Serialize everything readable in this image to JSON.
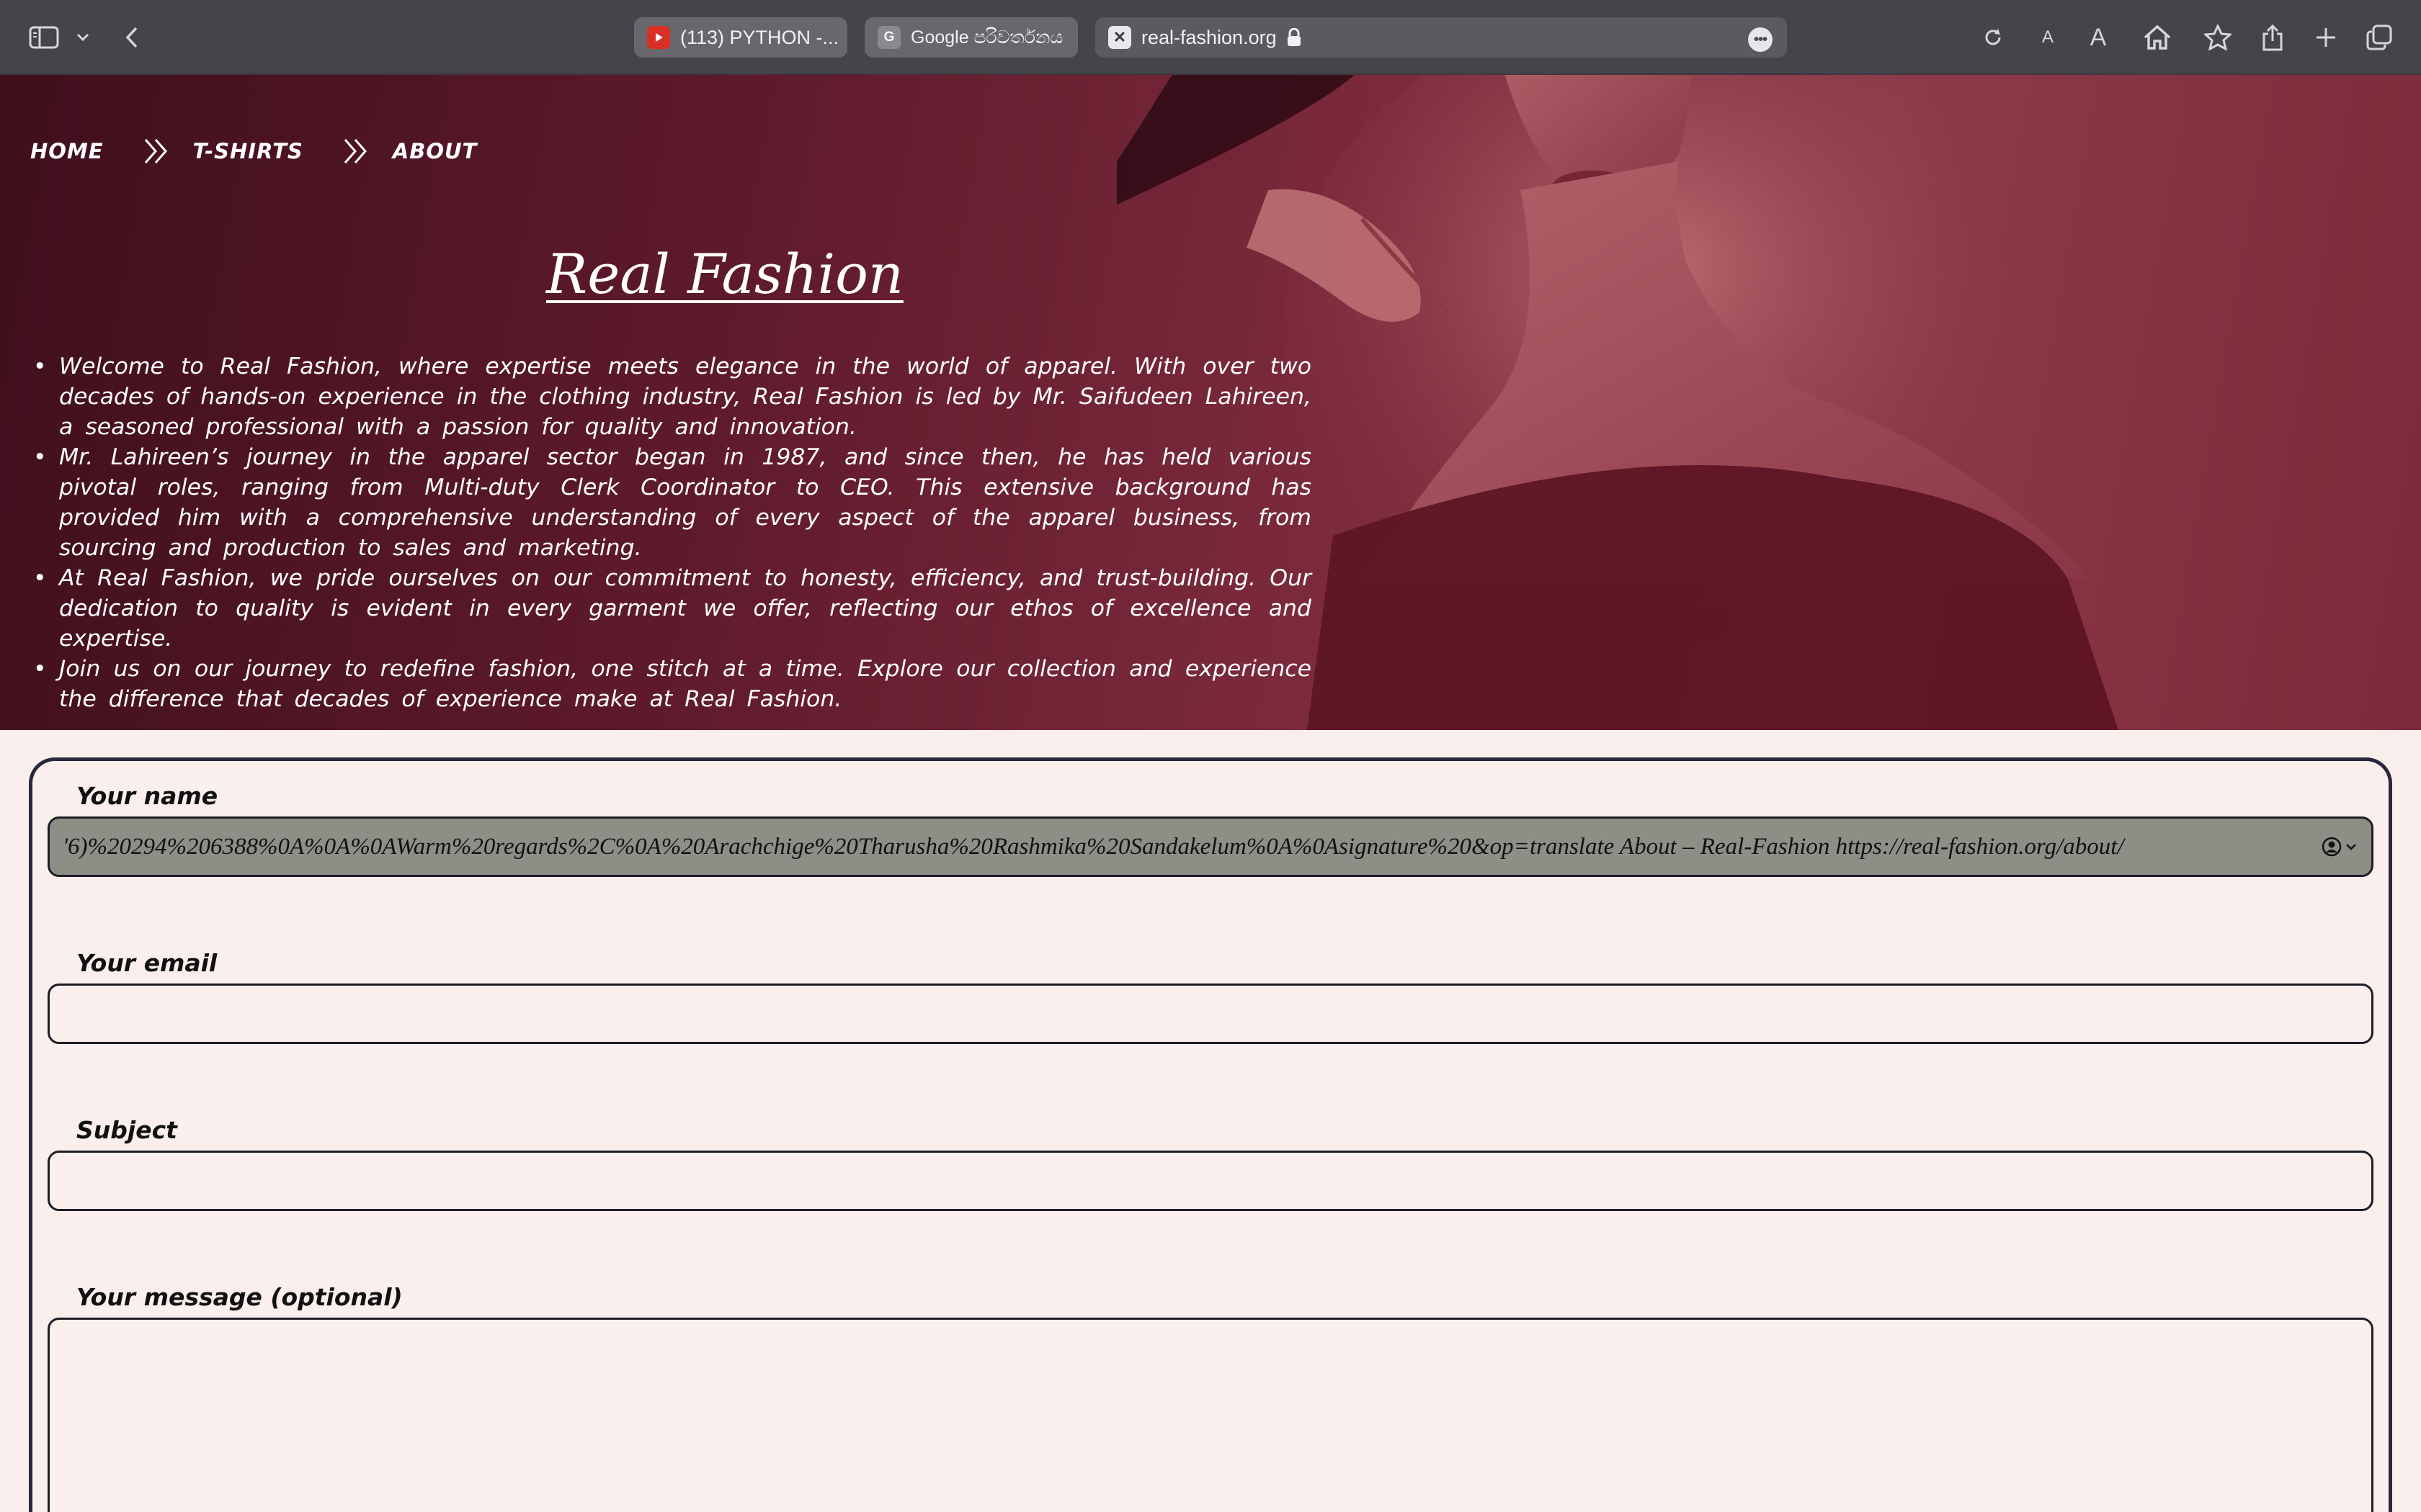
{
  "browser": {
    "tabs": [
      {
        "title": "(113) PYTHON -...",
        "icon": "youtube-icon",
        "favicon_color": "#d93025"
      },
      {
        "title": "Google පරිවර්තනය",
        "icon": "google-translate-icon",
        "favicon_letter": "G"
      },
      {
        "title": "real-fashion.org",
        "icon": "site-favicon-icon",
        "favicon_letter": "✕",
        "secure": true
      }
    ],
    "text_size_small": "A",
    "text_size_large": "A"
  },
  "site": {
    "nav": [
      "HOME",
      "T-SHIRTS",
      "ABOUT"
    ],
    "brand": "Real Fashion",
    "intro": [
      "Welcome to Real Fashion, where expertise meets elegance in the world of apparel. With over two decades of hands-on experience in the clothing industry, Real Fashion is led by Mr. Saifudeen Lahireen, a seasoned professional with a passion for quality and innovation.",
      "Mr. Lahireen’s journey in the apparel sector began in 1987, and since then, he has held various pivotal roles, ranging from Multi-duty Clerk Coordinator to CEO. This extensive background has provided him with a comprehensive understanding of every aspect of the apparel business, from sourcing and production to sales and marketing.",
      "At Real Fashion, we pride ourselves on our commitment to honesty, efficiency, and trust-building. Our dedication to quality is evident in every garment we offer, reflecting our ethos of excellence and expertise.",
      "Join us on our journey to redefine fashion, one stitch at a time. Explore our collection and experience the difference that decades of experience make at Real Fashion."
    ]
  },
  "form": {
    "name_label": "Your name",
    "name_value": "'6)%20294%206388%0A%0A%0AWarm%20regards%2C%0A%20Arachchige%20Tharusha%20Rashmika%20Sandakelum%0A%0Asignature%20&op=translate  About – Real-Fashion https://real-fashion.org/about/",
    "email_label": "Your email",
    "email_value": "",
    "subject_label": "Subject",
    "subject_value": "",
    "message_label": "Your message (optional)",
    "message_value": ""
  },
  "colors": {
    "chrome_bg": "#46444a",
    "hero_dark": "#3f0f1c",
    "hero_light": "#8f3a48",
    "page_bg": "#fbefed",
    "autofill_bg": "#8d8f87"
  }
}
